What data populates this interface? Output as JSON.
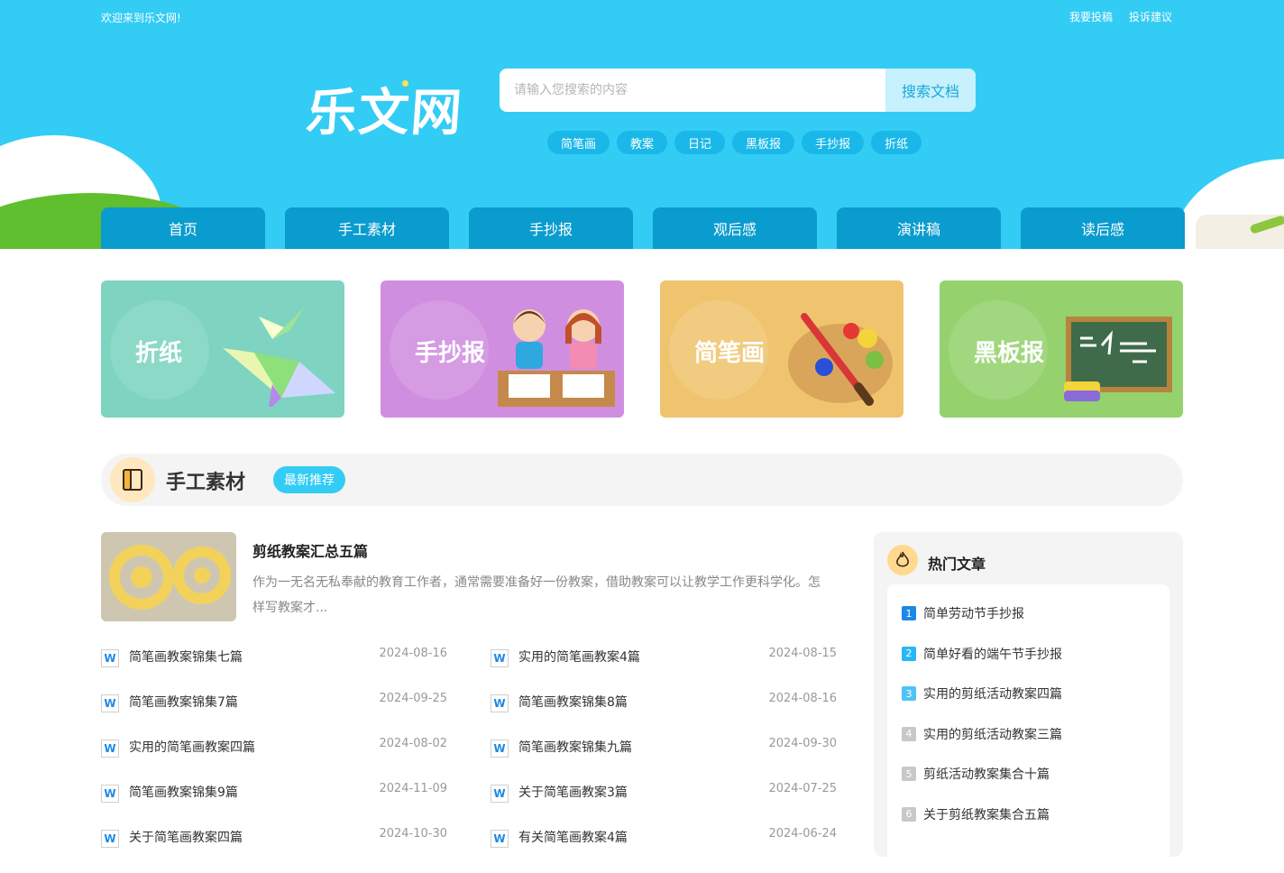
{
  "topbar": {
    "welcome": "欢迎来到乐文网!",
    "links": [
      "我要投稿",
      "投诉建议"
    ]
  },
  "logo": {
    "text": "乐文网"
  },
  "search": {
    "placeholder": "请输入您搜索的内容",
    "button": "搜索文档"
  },
  "tags": [
    "简笔画",
    "教案",
    "日记",
    "黑板报",
    "手抄报",
    "折纸"
  ],
  "nav": [
    "首页",
    "手工素材",
    "手抄报",
    "观后感",
    "演讲稿",
    "读后感"
  ],
  "categories": [
    {
      "label": "折纸",
      "color": "#7ed4c0"
    },
    {
      "label": "手抄报",
      "color": "#d08ee0"
    },
    {
      "label": "简笔画",
      "color": "#f0c46e"
    },
    {
      "label": "黑板报",
      "color": "#95d26e"
    }
  ],
  "section": {
    "title": "手工素材",
    "badge": "最新推荐"
  },
  "featured": {
    "title": "剪纸教案汇总五篇",
    "desc": "作为一无名无私奉献的教育工作者，通常需要准备好一份教案，借助教案可以让教学工作更科学化。怎样写教案才..."
  },
  "articles": [
    {
      "title": "简笔画教案锦集七篇",
      "date": "2024-08-16"
    },
    {
      "title": "实用的简笔画教案4篇",
      "date": "2024-08-15"
    },
    {
      "title": "简笔画教案锦集7篇",
      "date": "2024-09-25"
    },
    {
      "title": "简笔画教案锦集8篇",
      "date": "2024-08-16"
    },
    {
      "title": "实用的简笔画教案四篇",
      "date": "2024-08-02"
    },
    {
      "title": "简笔画教案锦集九篇",
      "date": "2024-09-30"
    },
    {
      "title": "简笔画教案锦集9篇",
      "date": "2024-11-09"
    },
    {
      "title": "关于简笔画教案3篇",
      "date": "2024-07-25"
    },
    {
      "title": "关于简笔画教案四篇",
      "date": "2024-10-30"
    },
    {
      "title": "有关简笔画教案4篇",
      "date": "2024-06-24"
    }
  ],
  "hot": {
    "title": "热门文章",
    "items": [
      {
        "num": "1",
        "color": "#1e88e5",
        "title": "简单劳动节手抄报"
      },
      {
        "num": "2",
        "color": "#29b6f6",
        "title": "简单好看的端午节手抄报"
      },
      {
        "num": "3",
        "color": "#4fc3f7",
        "title": "实用的剪纸活动教案四篇"
      },
      {
        "num": "4",
        "color": "#c8c8c8",
        "title": "实用的剪纸活动教案三篇"
      },
      {
        "num": "5",
        "color": "#c8c8c8",
        "title": "剪纸活动教案集合十篇"
      },
      {
        "num": "6",
        "color": "#c8c8c8",
        "title": "关于剪纸教案集合五篇"
      }
    ]
  }
}
